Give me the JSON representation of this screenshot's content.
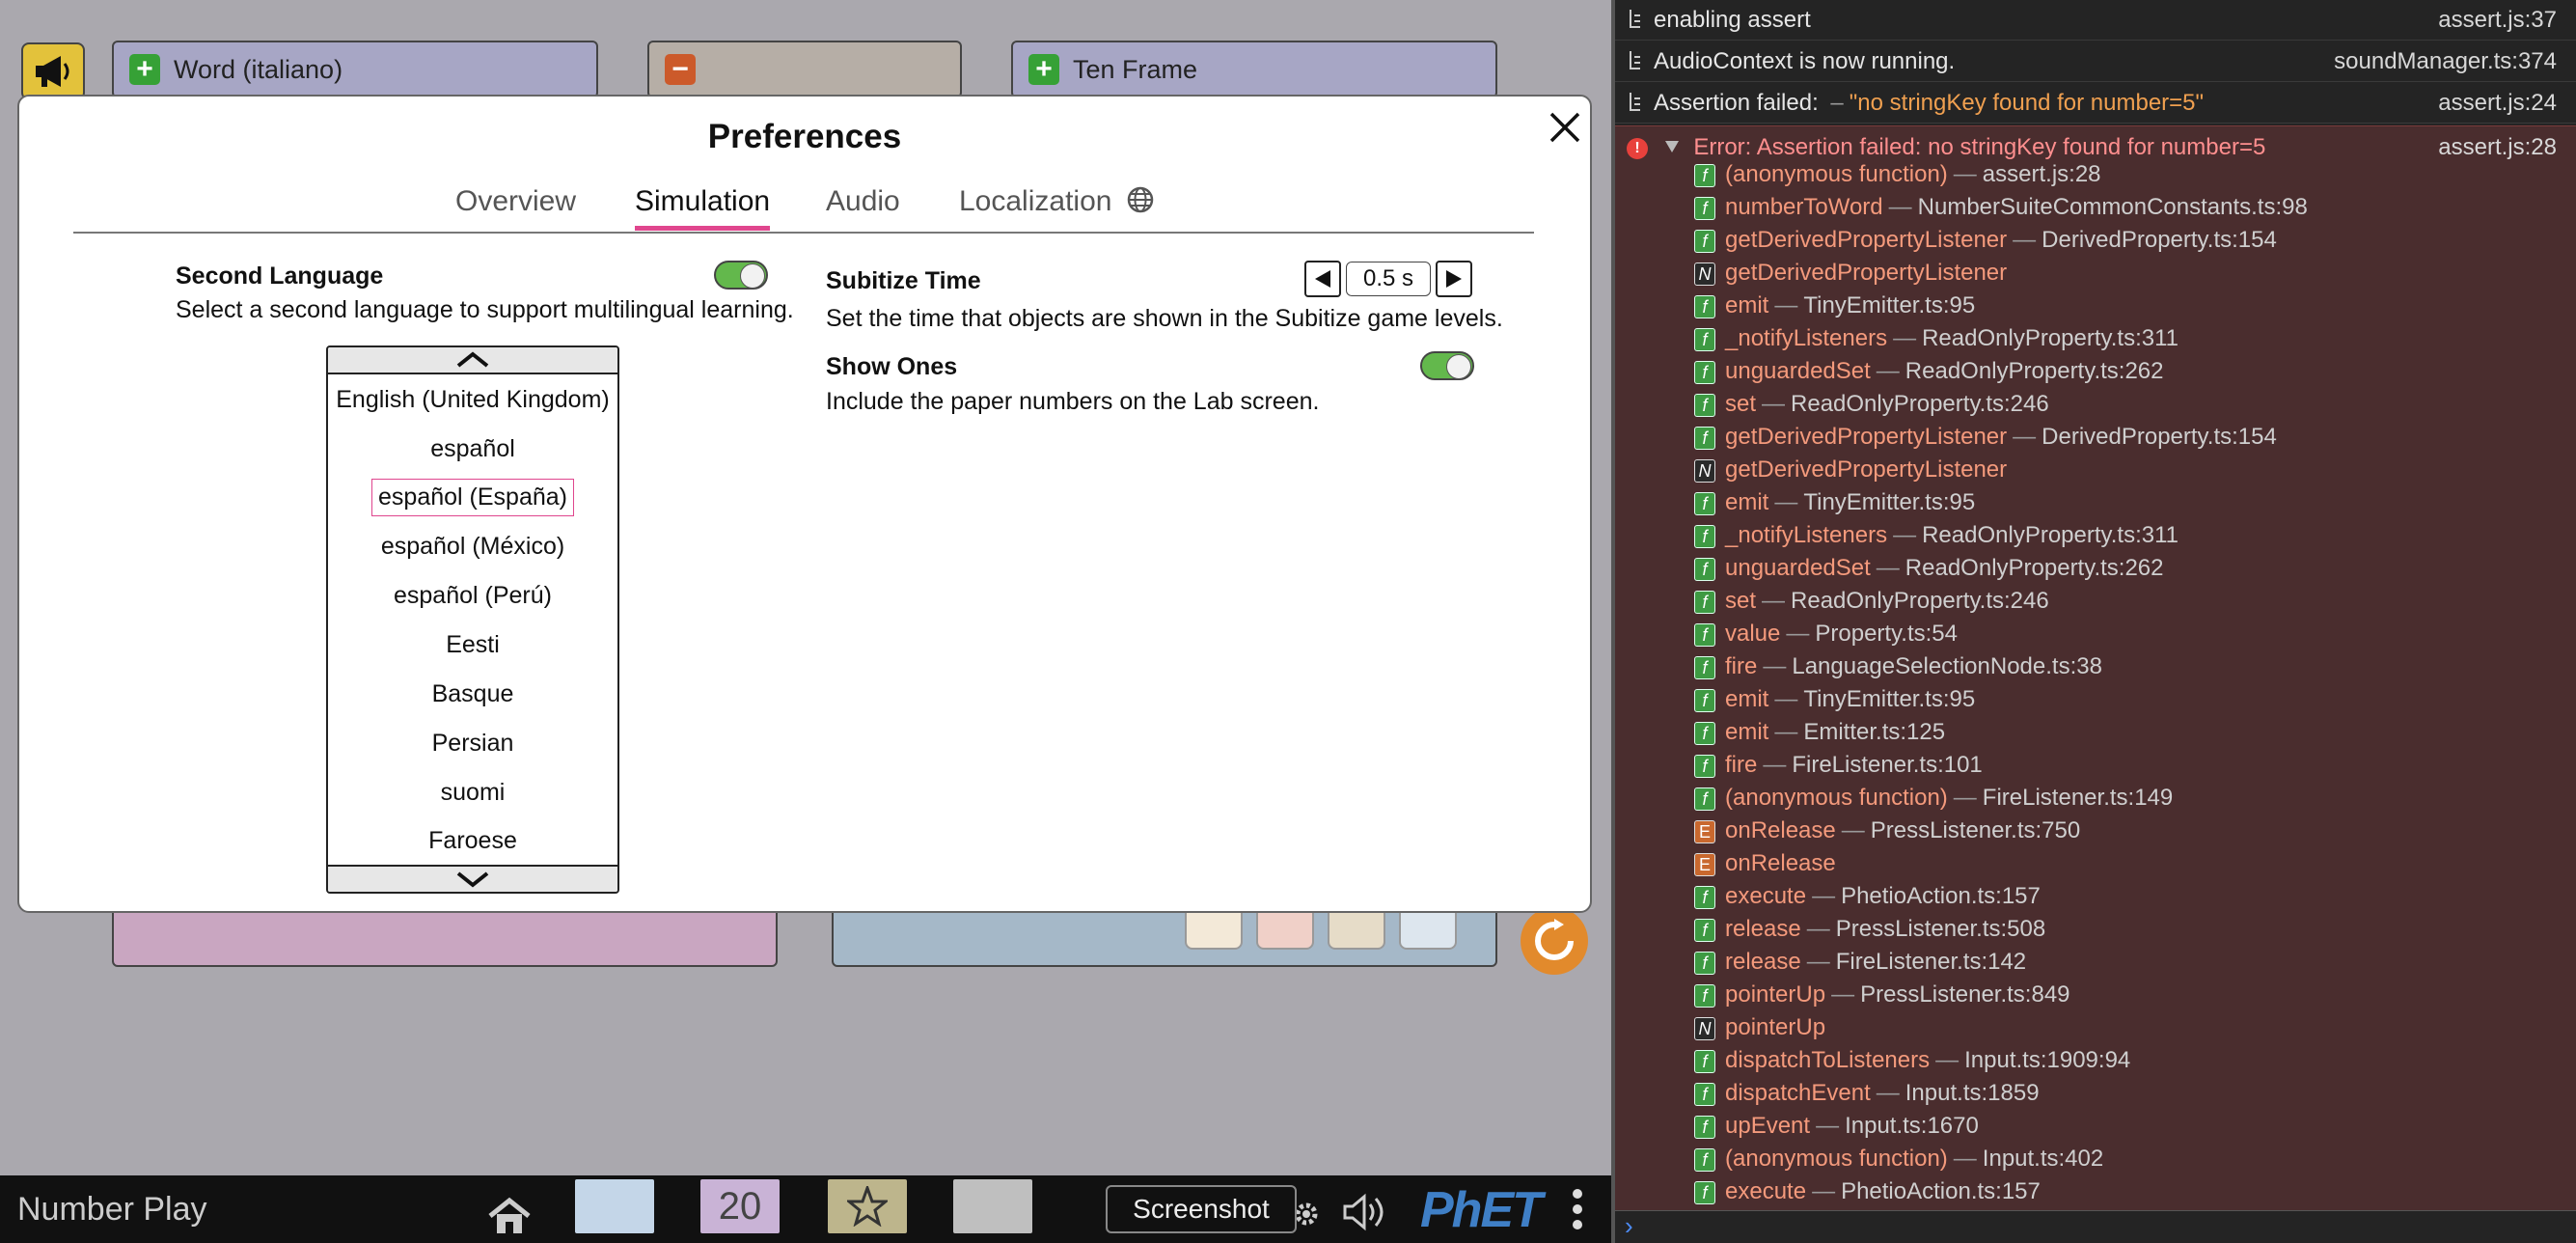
{
  "sim": {
    "accordions": {
      "word_title": "Word (italiano)",
      "middle_title": "",
      "ten_frame_title": "Ten Frame"
    },
    "navbar": {
      "title": "Number Play",
      "screen2_number": "20",
      "tooltip": "Screenshot",
      "logo": "PhET"
    }
  },
  "dialog": {
    "title": "Preferences",
    "tabs": [
      "Overview",
      "Simulation",
      "Audio",
      "Localization"
    ],
    "active_tab": "Simulation",
    "second_language": {
      "title": "Second Language",
      "description": "Select a second language to support multilingual learning.",
      "enabled": true,
      "languages": [
        "English (United Kingdom)",
        "español",
        "español (España)",
        "español (México)",
        "español (Perú)",
        "Eesti",
        "Basque",
        "Persian",
        "suomi",
        "Faroese"
      ],
      "selected": "español (España)"
    },
    "subitize_time": {
      "title": "Subitize Time",
      "value": "0.5 s",
      "description": "Set the time that objects are shown in the Subitize game levels."
    },
    "show_ones": {
      "title": "Show Ones",
      "description": "Include the paper numbers on the Lab screen.",
      "enabled": true
    }
  },
  "console": {
    "logs": [
      {
        "msg": "enabling assert",
        "src": "assert.js:37"
      },
      {
        "msg": "AudioContext is now running.",
        "src": "soundManager.ts:374"
      },
      {
        "msg": "Assertion failed: ",
        "extra": "\"no stringKey found for number=5\"",
        "src": "assert.js:24"
      }
    ],
    "error": {
      "header": "Error: Assertion failed: no stringKey found for number=5",
      "src": "assert.js:28",
      "frames": [
        {
          "t": "f",
          "fn": "(anonymous function)",
          "file": "assert.js:28"
        },
        {
          "t": "f",
          "fn": "numberToWord",
          "file": "NumberSuiteCommonConstants.ts:98"
        },
        {
          "t": "f",
          "fn": "getDerivedPropertyListener",
          "file": "DerivedProperty.ts:154"
        },
        {
          "t": "N",
          "fn": "getDerivedPropertyListener",
          "file": ""
        },
        {
          "t": "f",
          "fn": "emit",
          "file": "TinyEmitter.ts:95"
        },
        {
          "t": "f",
          "fn": "_notifyListeners",
          "file": "ReadOnlyProperty.ts:311"
        },
        {
          "t": "f",
          "fn": "unguardedSet",
          "file": "ReadOnlyProperty.ts:262"
        },
        {
          "t": "f",
          "fn": "set",
          "file": "ReadOnlyProperty.ts:246"
        },
        {
          "t": "f",
          "fn": "getDerivedPropertyListener",
          "file": "DerivedProperty.ts:154"
        },
        {
          "t": "N",
          "fn": "getDerivedPropertyListener",
          "file": ""
        },
        {
          "t": "f",
          "fn": "emit",
          "file": "TinyEmitter.ts:95"
        },
        {
          "t": "f",
          "fn": "_notifyListeners",
          "file": "ReadOnlyProperty.ts:311"
        },
        {
          "t": "f",
          "fn": "unguardedSet",
          "file": "ReadOnlyProperty.ts:262"
        },
        {
          "t": "f",
          "fn": "set",
          "file": "ReadOnlyProperty.ts:246"
        },
        {
          "t": "f",
          "fn": "value",
          "file": "Property.ts:54"
        },
        {
          "t": "f",
          "fn": "fire",
          "file": "LanguageSelectionNode.ts:38"
        },
        {
          "t": "f",
          "fn": "emit",
          "file": "TinyEmitter.ts:95"
        },
        {
          "t": "f",
          "fn": "emit",
          "file": "Emitter.ts:125"
        },
        {
          "t": "f",
          "fn": "fire",
          "file": "FireListener.ts:101"
        },
        {
          "t": "f",
          "fn": "(anonymous function)",
          "file": "FireListener.ts:149"
        },
        {
          "t": "E",
          "fn": "onRelease",
          "file": "PressListener.ts:750"
        },
        {
          "t": "E",
          "fn": "onRelease",
          "file": ""
        },
        {
          "t": "f",
          "fn": "execute",
          "file": "PhetioAction.ts:157"
        },
        {
          "t": "f",
          "fn": "release",
          "file": "PressListener.ts:508"
        },
        {
          "t": "f",
          "fn": "release",
          "file": "FireListener.ts:142"
        },
        {
          "t": "f",
          "fn": "pointerUp",
          "file": "PressListener.ts:849"
        },
        {
          "t": "N",
          "fn": "pointerUp",
          "file": ""
        },
        {
          "t": "f",
          "fn": "dispatchToListeners",
          "file": "Input.ts:1909:94"
        },
        {
          "t": "f",
          "fn": "dispatchEvent",
          "file": "Input.ts:1859"
        },
        {
          "t": "f",
          "fn": "upEvent",
          "file": "Input.ts:1670"
        },
        {
          "t": "f",
          "fn": "(anonymous function)",
          "file": "Input.ts:402"
        },
        {
          "t": "f",
          "fn": "execute",
          "file": "PhetioAction.ts:157"
        }
      ]
    },
    "prompt": "›"
  },
  "colors": {
    "accent_pink": "#e0468e",
    "toggle_green": "#63b84c",
    "error_bg": "#4a2d2e",
    "function_name": "#f49a7c",
    "badge_green": "#3e9a43"
  },
  "icons": {
    "speaker": "megaphone-icon",
    "close": "close-x-icon",
    "globe": "globe-icon",
    "home": "home-icon",
    "gear": "gear-icon",
    "sound": "speaker-volume-icon",
    "refresh": "refresh-icon"
  }
}
